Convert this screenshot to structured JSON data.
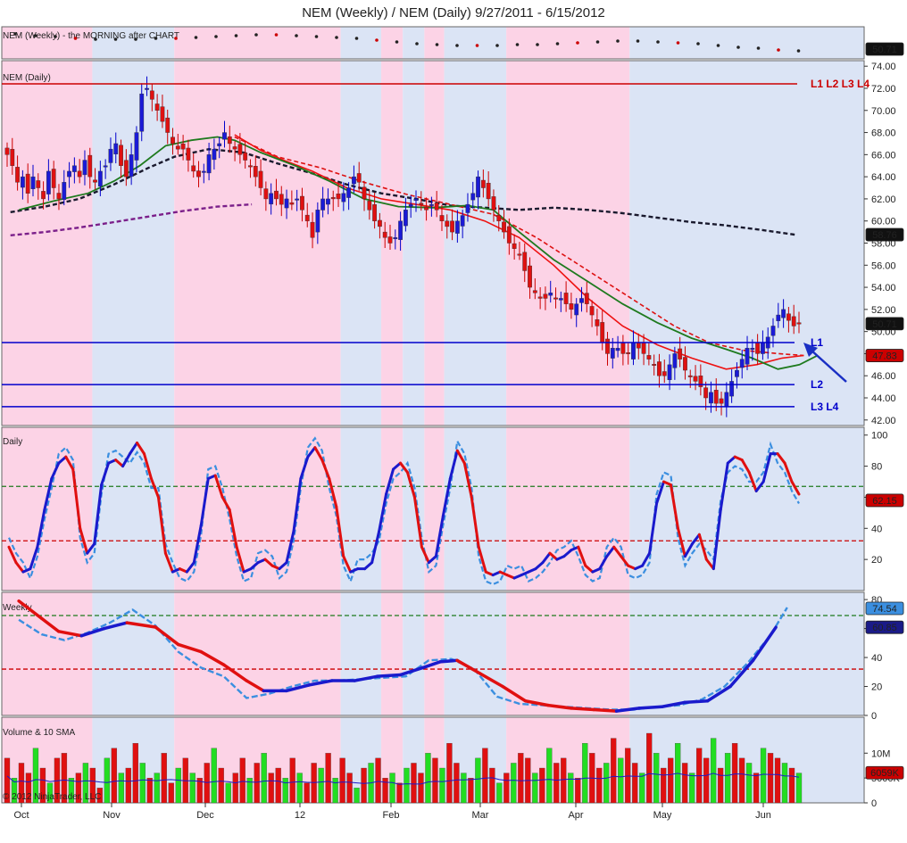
{
  "chart_data": {
    "type": "candlestick",
    "title": "NEM (Weekly) / NEM (Daily)  9/27/2011 - 6/15/2012",
    "x_tick_labels": [
      "Oct",
      "Nov",
      "Dec",
      "12",
      "Feb",
      "Mar",
      "Apr",
      "May",
      "Jun"
    ],
    "top_strip": {
      "label": "NEM (Weekly) - the MORNING after CHART",
      "price_tag": "50.71"
    },
    "price_panel": {
      "label": "NEM (Daily)",
      "ylim": [
        41.5,
        74.5
      ],
      "y_ticks": [
        "74.00",
        "72.00",
        "70.00",
        "68.00",
        "66.00",
        "64.00",
        "62.00",
        "60.00",
        "58.00",
        "56.00",
        "54.00",
        "52.00",
        "50.00",
        "48.00",
        "46.00",
        "44.00",
        "42.00"
      ],
      "level_lines": [
        {
          "label": "L1 L2 L3 L4",
          "value": 72.4,
          "color": "#cc0000"
        },
        {
          "label": "L1",
          "value": 49.0,
          "color": "#0000cc"
        },
        {
          "label": "L2",
          "value": 45.2,
          "color": "#0000cc"
        },
        {
          "label": "L3 L4",
          "value": 43.2,
          "color": "#0000cc"
        }
      ],
      "price_tags": [
        {
          "text": "58.76",
          "value": 58.76,
          "style": "dark"
        },
        {
          "text": "50.71",
          "value": 50.71,
          "style": "dark"
        },
        {
          "text": "47.83",
          "value": 47.83,
          "style": "red"
        }
      ],
      "closes": [
        66,
        65,
        63.5,
        64,
        62.5,
        64,
        63,
        62,
        64.5,
        63,
        62,
        63.5,
        64.5,
        65,
        64,
        65.5,
        64,
        63.5,
        64.5,
        65,
        66.5,
        67,
        65,
        64,
        66,
        68,
        71.5,
        72,
        71,
        70,
        69,
        68,
        67,
        66.5,
        66.5,
        65.5,
        64.5,
        64,
        64.5,
        66,
        66.5,
        67,
        68,
        67,
        66.5,
        66,
        65.5,
        65,
        64,
        63,
        62,
        62.5,
        62,
        61.5,
        62,
        61.5,
        62,
        61,
        60,
        58.5,
        61,
        62,
        62,
        62,
        62,
        62.5,
        63,
        64,
        63.5,
        62,
        61,
        60,
        59.5,
        58.5,
        58,
        58.5,
        60,
        61,
        61.5,
        62,
        61.5,
        61,
        61.5,
        61,
        60,
        59.5,
        59,
        60,
        60.5,
        61.5,
        62.5,
        64,
        63,
        62,
        61,
        60,
        59,
        58,
        57.5,
        57,
        55.5,
        54,
        53.5,
        53,
        53,
        53.5,
        53,
        53,
        52.5,
        52,
        52.5,
        53,
        52.5,
        51.5,
        50.5,
        49,
        48,
        48.5,
        48.5,
        48,
        48,
        49,
        48.5,
        48,
        47.5,
        47,
        46,
        46,
        47,
        48,
        47.5,
        46.5,
        46,
        45.5,
        45,
        44,
        44.5,
        43.5,
        43.5,
        44.5,
        45.5,
        46.5,
        47.5,
        48.5,
        48.5,
        48,
        49,
        49.5,
        50.5,
        51.5,
        52,
        51,
        50.5,
        50.71
      ],
      "sma_green": [
        [
          0.02,
          61.0
        ],
        [
          0.06,
          61.8
        ],
        [
          0.1,
          62.5
        ],
        [
          0.13,
          63.6
        ],
        [
          0.16,
          65.0
        ],
        [
          0.19,
          66.8
        ],
        [
          0.22,
          67.3
        ],
        [
          0.25,
          67.6
        ],
        [
          0.27,
          67.3
        ],
        [
          0.3,
          66.2
        ],
        [
          0.34,
          65.0
        ],
        [
          0.38,
          63.6
        ],
        [
          0.42,
          62.0
        ],
        [
          0.46,
          61.3
        ],
        [
          0.5,
          61.2
        ],
        [
          0.54,
          61.4
        ],
        [
          0.57,
          61.0
        ],
        [
          0.6,
          59.0
        ],
        [
          0.64,
          56.5
        ],
        [
          0.68,
          54.5
        ],
        [
          0.72,
          52.5
        ],
        [
          0.76,
          50.8
        ],
        [
          0.8,
          49.4
        ],
        [
          0.84,
          48.4
        ],
        [
          0.87,
          47.6
        ],
        [
          0.9,
          46.6
        ],
        [
          0.925,
          47.0
        ],
        [
          0.945,
          47.8
        ]
      ],
      "sma_black_dash": [
        [
          0.01,
          60.8
        ],
        [
          0.05,
          61.3
        ],
        [
          0.09,
          62.0
        ],
        [
          0.13,
          63.3
        ],
        [
          0.17,
          64.8
        ],
        [
          0.2,
          65.8
        ],
        [
          0.24,
          66.5
        ],
        [
          0.28,
          66.2
        ],
        [
          0.32,
          65.2
        ],
        [
          0.36,
          64.3
        ],
        [
          0.4,
          63.3
        ],
        [
          0.44,
          62.5
        ],
        [
          0.48,
          62.0
        ],
        [
          0.52,
          61.4
        ],
        [
          0.56,
          61.2
        ],
        [
          0.6,
          61.0
        ],
        [
          0.64,
          61.2
        ],
        [
          0.68,
          61.0
        ],
        [
          0.72,
          60.7
        ],
        [
          0.76,
          60.3
        ],
        [
          0.8,
          59.9
        ],
        [
          0.84,
          59.6
        ],
        [
          0.88,
          59.2
        ],
        [
          0.92,
          58.76
        ]
      ],
      "sma_purple_dash": [
        [
          0.01,
          58.7
        ],
        [
          0.05,
          59.0
        ],
        [
          0.09,
          59.4
        ],
        [
          0.13,
          59.9
        ],
        [
          0.17,
          60.4
        ],
        [
          0.21,
          60.9
        ],
        [
          0.25,
          61.3
        ],
        [
          0.29,
          61.5
        ]
      ],
      "sma_red": [
        [
          0.27,
          67.8
        ],
        [
          0.3,
          66.4
        ],
        [
          0.33,
          65.4
        ],
        [
          0.36,
          64.5
        ],
        [
          0.4,
          63.0
        ],
        [
          0.44,
          62.0
        ],
        [
          0.48,
          61.5
        ],
        [
          0.52,
          61.0
        ],
        [
          0.56,
          60.0
        ],
        [
          0.6,
          58.5
        ],
        [
          0.64,
          56.0
        ],
        [
          0.68,
          53.0
        ],
        [
          0.72,
          50.5
        ],
        [
          0.76,
          48.8
        ],
        [
          0.8,
          47.6
        ],
        [
          0.84,
          46.6
        ],
        [
          0.875,
          47.0
        ],
        [
          0.905,
          47.6
        ],
        [
          0.93,
          47.83
        ]
      ],
      "sma_red_dash": [
        [
          0.27,
          67.6
        ],
        [
          0.32,
          65.8
        ],
        [
          0.37,
          64.8
        ],
        [
          0.42,
          63.5
        ],
        [
          0.47,
          62.4
        ],
        [
          0.52,
          61.5
        ],
        [
          0.57,
          60.6
        ],
        [
          0.62,
          58.5
        ],
        [
          0.66,
          56.5
        ],
        [
          0.7,
          54.5
        ],
        [
          0.74,
          52.5
        ],
        [
          0.78,
          50.5
        ],
        [
          0.82,
          49.0
        ],
        [
          0.86,
          48.3
        ],
        [
          0.9,
          48.0
        ],
        [
          0.93,
          47.83
        ]
      ]
    },
    "daily_osc": {
      "label": "Daily",
      "ylim": [
        0,
        105
      ],
      "y_ticks": [
        "100",
        "80",
        "60",
        "40",
        "20"
      ],
      "bands": [
        32,
        67
      ],
      "value_tag": "62.15",
      "k_values": [
        28,
        18,
        12,
        14,
        28,
        52,
        72,
        82,
        86,
        78,
        40,
        24,
        30,
        68,
        82,
        84,
        80,
        88,
        95,
        88,
        72,
        60,
        24,
        12,
        14,
        12,
        18,
        42,
        72,
        74,
        60,
        52,
        28,
        12,
        14,
        18,
        20,
        16,
        14,
        18,
        38,
        72,
        86,
        92,
        84,
        72,
        54,
        22,
        12,
        14,
        14,
        18,
        38,
        62,
        78,
        82,
        76,
        60,
        28,
        18,
        22,
        48,
        72,
        90,
        82,
        60,
        28,
        12,
        10,
        12,
        10,
        8,
        10,
        12,
        14,
        18,
        24,
        20,
        22,
        26,
        28,
        16,
        12,
        14,
        22,
        28,
        22,
        16,
        14,
        16,
        24,
        56,
        70,
        68,
        40,
        22,
        30,
        36,
        20,
        14,
        52,
        82,
        86,
        84,
        76,
        64,
        70,
        88,
        88,
        82,
        70,
        62
      ]
    },
    "weekly_osc": {
      "label": "Weekly",
      "ylim": [
        0,
        85
      ],
      "y_ticks": [
        "80",
        "60",
        "40",
        "20",
        "0"
      ],
      "bands": [
        32,
        69
      ],
      "value_tags": [
        {
          "text": "74.54",
          "value": 74.54
        },
        {
          "text": "60.85",
          "value": 60.85
        }
      ],
      "k_series": [
        [
          0.03,
          79
        ],
        [
          0.07,
          67
        ],
        [
          0.1,
          58
        ],
        [
          0.14,
          55
        ],
        [
          0.18,
          60
        ],
        [
          0.22,
          64
        ],
        [
          0.27,
          61
        ],
        [
          0.31,
          49
        ],
        [
          0.35,
          44
        ],
        [
          0.39,
          35
        ],
        [
          0.43,
          24
        ],
        [
          0.46,
          17
        ],
        [
          0.5,
          17
        ],
        [
          0.54,
          21
        ],
        [
          0.58,
          24
        ],
        [
          0.62,
          24
        ],
        [
          0.66,
          27
        ],
        [
          0.7,
          28
        ],
        [
          0.74,
          33
        ],
        [
          0.77,
          37
        ],
        [
          0.8,
          38
        ],
        [
          0.84,
          29
        ],
        [
          0.88,
          20
        ],
        [
          0.92,
          10
        ],
        [
          0.96,
          7
        ],
        [
          1.0,
          5
        ],
        [
          1.04,
          4
        ],
        [
          1.08,
          3
        ],
        [
          1.12,
          5
        ],
        [
          1.16,
          6
        ],
        [
          1.2,
          9
        ],
        [
          1.24,
          10
        ],
        [
          1.28,
          20
        ],
        [
          1.32,
          38
        ],
        [
          1.36,
          60.85
        ]
      ],
      "d_series": [
        [
          0.03,
          66
        ],
        [
          0.07,
          56
        ],
        [
          0.11,
          52
        ],
        [
          0.15,
          57
        ],
        [
          0.19,
          64
        ],
        [
          0.23,
          73
        ],
        [
          0.27,
          62
        ],
        [
          0.31,
          44
        ],
        [
          0.35,
          33
        ],
        [
          0.39,
          27
        ],
        [
          0.43,
          12
        ],
        [
          0.47,
          15
        ],
        [
          0.51,
          20
        ],
        [
          0.55,
          24
        ],
        [
          0.59,
          24
        ],
        [
          0.63,
          25
        ],
        [
          0.67,
          26
        ],
        [
          0.71,
          27
        ],
        [
          0.75,
          38
        ],
        [
          0.79,
          39
        ],
        [
          0.83,
          32
        ],
        [
          0.87,
          13
        ],
        [
          0.91,
          8
        ],
        [
          0.95,
          7
        ],
        [
          0.99,
          6
        ],
        [
          1.03,
          5
        ],
        [
          1.07,
          4
        ],
        [
          1.11,
          4
        ],
        [
          1.15,
          6
        ],
        [
          1.19,
          7
        ],
        [
          1.23,
          11
        ],
        [
          1.27,
          20
        ],
        [
          1.31,
          36
        ],
        [
          1.35,
          55
        ],
        [
          1.38,
          74.54
        ]
      ]
    },
    "volume": {
      "label": "Volume & 10 SMA",
      "y_ticks": [
        "10M",
        "5000K",
        "0"
      ],
      "value_tag": "6059K",
      "copyright": "© 2012 NinjaTrader, LLC",
      "bars": [
        9,
        5,
        8,
        6,
        11,
        7,
        4,
        9,
        10,
        5,
        6,
        8,
        7,
        3,
        9,
        11,
        6,
        7,
        12,
        8,
        5,
        6,
        10,
        4,
        7,
        9,
        6,
        5,
        8,
        11,
        7,
        4,
        6,
        9,
        5,
        8,
        10,
        6,
        7,
        5,
        9,
        6,
        4,
        8,
        7,
        10,
        5,
        9,
        6,
        3,
        7,
        8,
        9,
        5,
        6,
        4,
        7,
        8,
        6,
        10,
        9,
        7,
        12,
        8,
        6,
        5,
        9,
        11,
        7,
        4,
        6,
        8,
        10,
        9,
        6,
        7,
        11,
        8,
        9,
        6,
        5,
        12,
        10,
        7,
        8,
        13,
        9,
        11,
        8,
        6,
        14,
        10,
        7,
        9,
        12,
        8,
        6,
        11,
        9,
        13,
        7,
        10,
        12,
        9,
        8,
        6,
        11,
        10,
        9,
        8,
        7,
        6
      ],
      "colors": [
        "g",
        "r"
      ]
    }
  }
}
